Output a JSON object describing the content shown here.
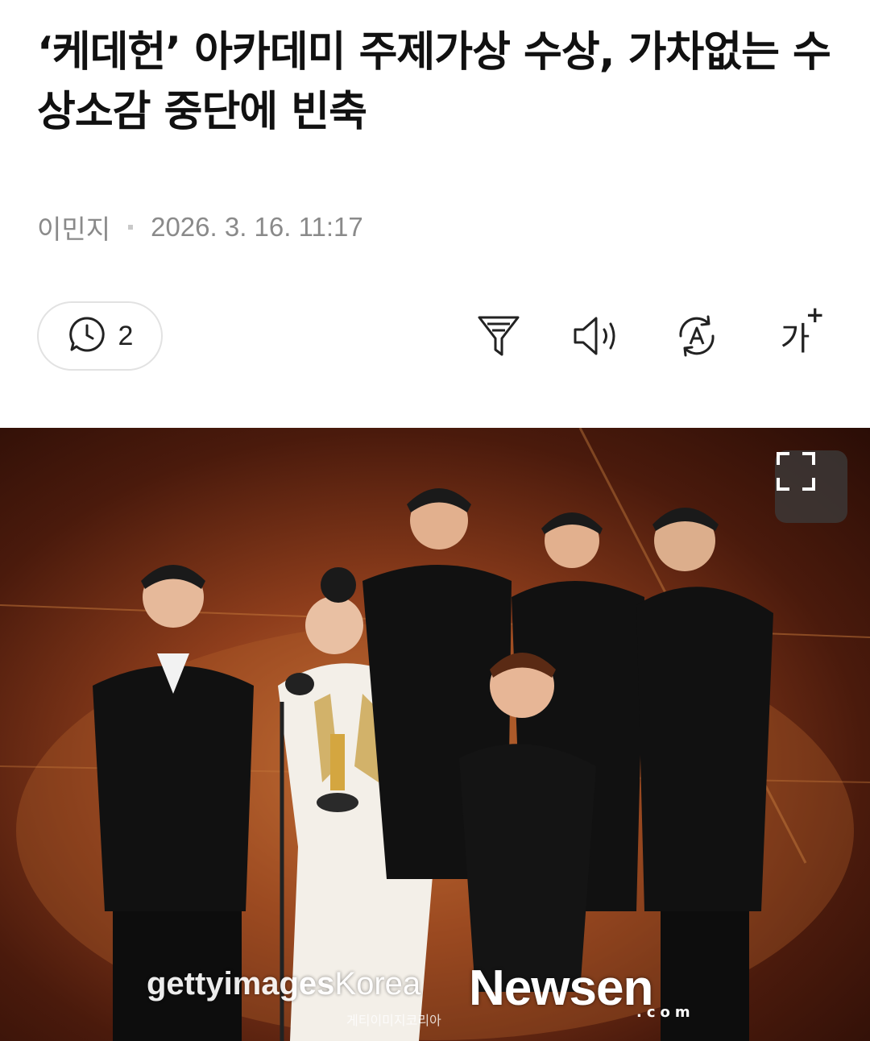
{
  "article": {
    "headline": "‘케데헌’ 아카데미 주제가상 수상, 가차없는 수상소감 중단에 빈축",
    "author": "이민지",
    "datetime": "2026. 3. 16. 11:17"
  },
  "toolbar": {
    "comment_count": "2",
    "comment_icon": "comment-clock-icon",
    "filter_icon": "filter-icon",
    "speaker_icon": "speaker-icon",
    "translate_icon": "translate-icon",
    "font_size_label": "가",
    "font_size_plus": "+"
  },
  "photo": {
    "expand_icon": "expand-icon",
    "credit_getty": "gettyimages",
    "credit_korea": "Korea",
    "credit_sub": "게티이미지코리아",
    "brand": "Newsen",
    "brand_sub": ".com"
  },
  "colors": {
    "text": "#111111",
    "meta": "#8a8a8a",
    "border": "#e2e2e2",
    "photo_bg": "#8f3e1c"
  }
}
